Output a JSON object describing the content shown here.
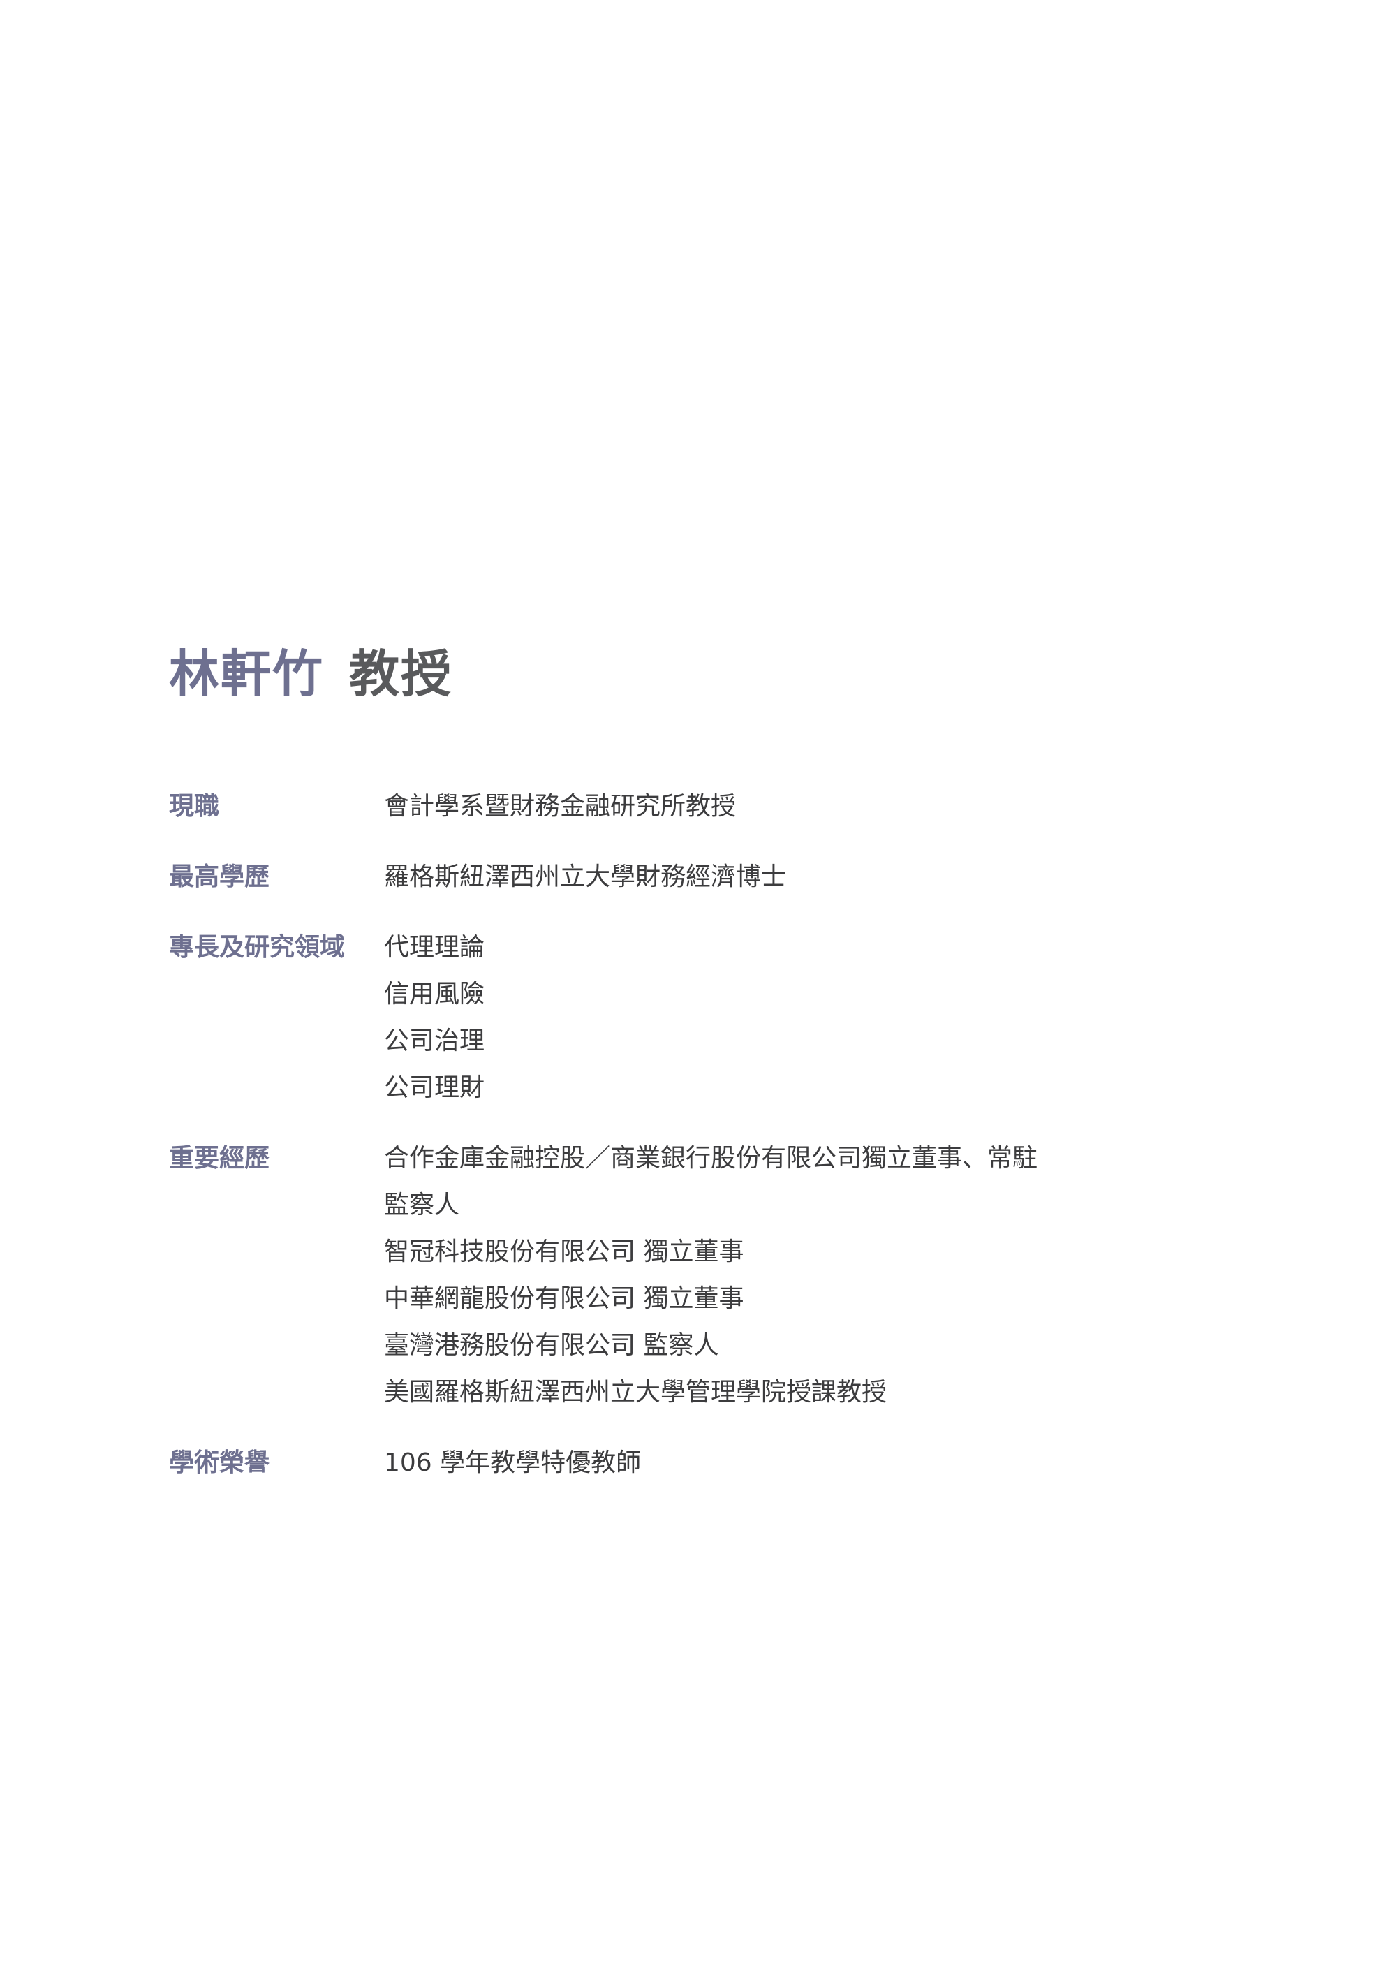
{
  "profile": {
    "name": "林軒竹",
    "rank": "教授"
  },
  "sections": {
    "current_position": {
      "label": "現職",
      "items": [
        "會計學系暨財務金融研究所教授"
      ]
    },
    "education": {
      "label": "最高學歷",
      "items": [
        "羅格斯紐澤西州立大學財務經濟博士"
      ]
    },
    "expertise": {
      "label": "專長及研究領域",
      "items": [
        "代理理論",
        "信用風險",
        "公司治理",
        "公司理財"
      ]
    },
    "experience": {
      "label": "重要經歷",
      "items": [
        "合作金庫金融控股／商業銀行股份有限公司獨立董事、常駐",
        "監察人",
        "智冠科技股份有限公司 獨立董事",
        "中華網龍股份有限公司 獨立董事",
        "臺灣港務股份有限公司 監察人",
        "美國羅格斯紐澤西州立大學管理學院授課教授"
      ]
    },
    "honors": {
      "label": "學術榮譽",
      "items": [
        "106 學年教學特優教師"
      ]
    }
  }
}
